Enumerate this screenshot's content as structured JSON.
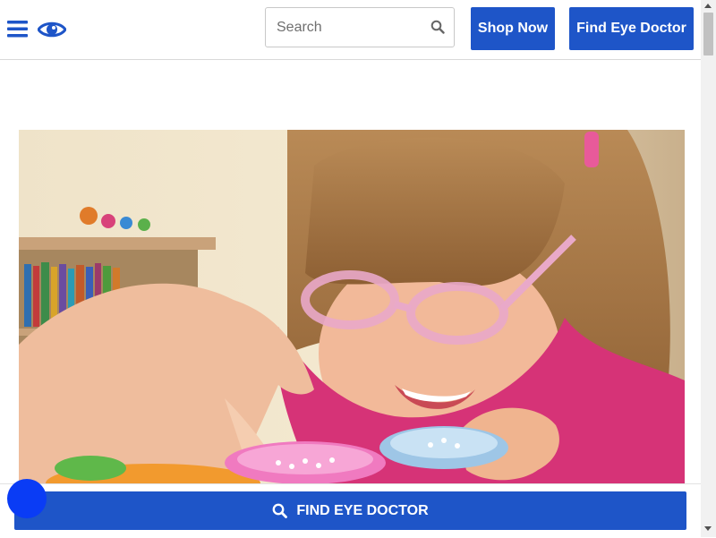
{
  "header": {
    "menu_icon": "hamburger-menu-icon",
    "logo_icon": "eye-icon",
    "search": {
      "placeholder": "Search",
      "value": "",
      "icon": "search-icon"
    },
    "shop_now_label": "Shop Now",
    "find_eye_doctor_label": "Find Eye Doctor"
  },
  "hero": {
    "image_description": "Young girl wearing pink eyeglasses smiling at colorful toy containers"
  },
  "bottom_bar": {
    "label": "FIND EYE DOCTOR",
    "icon": "search-icon"
  },
  "colors": {
    "brand_blue": "#1e55c8",
    "chat_bubble": "#0a3cf5"
  }
}
